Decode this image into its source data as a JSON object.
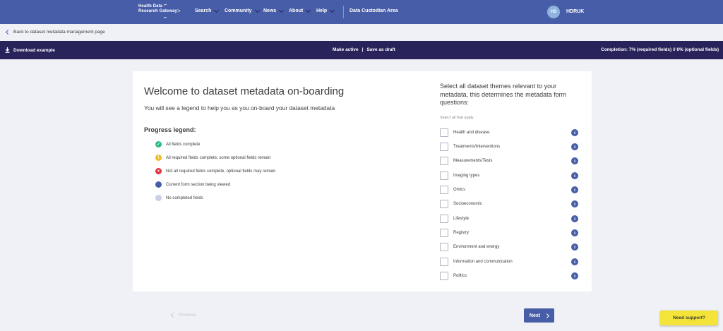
{
  "nav": {
    "logo_line1": "Health Data",
    "logo_line2": "Research Gateway",
    "items": [
      {
        "label": "Search"
      },
      {
        "label": "Community"
      },
      {
        "label": "News"
      },
      {
        "label": "About"
      },
      {
        "label": "Help"
      }
    ],
    "area": "Data Custodian Area",
    "user_initials": "HS",
    "user_name": "HDRUK"
  },
  "back_link": "Back to dataset metadata management page",
  "action_bar": {
    "download": "Download example",
    "make_active": "Make active",
    "separator": "|",
    "save_draft": "Save as draft",
    "completion": "Completion: 7% (required fields) // 6% (optional fields)"
  },
  "main": {
    "title": "Welcome to dataset metadata on-boarding",
    "subtitle": "You will see a legend to help you as you on-board your dataset metadata",
    "legend_title": "Progress legend:",
    "legend": [
      {
        "label": "All fields complete",
        "color": "#2cbb7f",
        "icon": "check-icon"
      },
      {
        "label": "All required fields complete, some optional fields remain",
        "color": "#f0bb24",
        "icon": "exclamation-icon"
      },
      {
        "label": "Not all required fields complete, optional fields may remain",
        "color": "#dc3645",
        "icon": "cross-icon"
      },
      {
        "label": "Current form section being viewed",
        "color": "#475da7",
        "icon": "current-dot-icon"
      },
      {
        "label": "No completed fields",
        "color": "#c9cfe6",
        "icon": "empty-dot-icon"
      }
    ]
  },
  "themes": {
    "title": "Select all dataset themes relevant to your metadata, this determines the metadata form questions:",
    "hint": "Select all that apply",
    "items": [
      {
        "label": "Health and disease"
      },
      {
        "label": "Treatments/Interventions"
      },
      {
        "label": "Measurements/Tests"
      },
      {
        "label": "Imaging types"
      },
      {
        "label": "Omics"
      },
      {
        "label": "Socioeconomic"
      },
      {
        "label": "Lifestyle"
      },
      {
        "label": "Registry"
      },
      {
        "label": "Environment and energy"
      },
      {
        "label": "Information and communication"
      },
      {
        "label": "Politics"
      }
    ],
    "info_glyph": "i"
  },
  "footer": {
    "previous": "Previous",
    "next": "Next",
    "support": "Need support?"
  },
  "colors": {
    "nav_bg": "#475da7",
    "action_bg": "#29235c",
    "support_bg": "#f4e43a"
  }
}
